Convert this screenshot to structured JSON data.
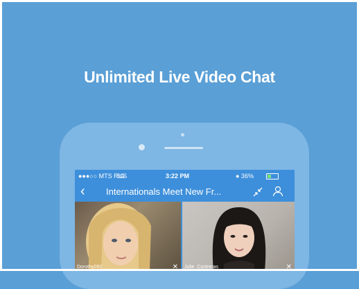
{
  "headline": "Unlimited Live Video Chat",
  "status_bar": {
    "carrier": "●●●○○ MTS RUS",
    "network": "3G",
    "time": "3:22 PM",
    "battery": "● 36%",
    "battery_level": 0.36
  },
  "nav": {
    "back_icon": "‹",
    "title": "Internationals Meet New Fr..."
  },
  "videos": [
    {
      "name": "Dorothy092",
      "close": "✕"
    },
    {
      "name": "Julie_Contreras",
      "close": "✕"
    }
  ],
  "colors": {
    "background": "#5a9fd6",
    "phone": "#7eb6e4",
    "screen": "#3d8fdb"
  }
}
